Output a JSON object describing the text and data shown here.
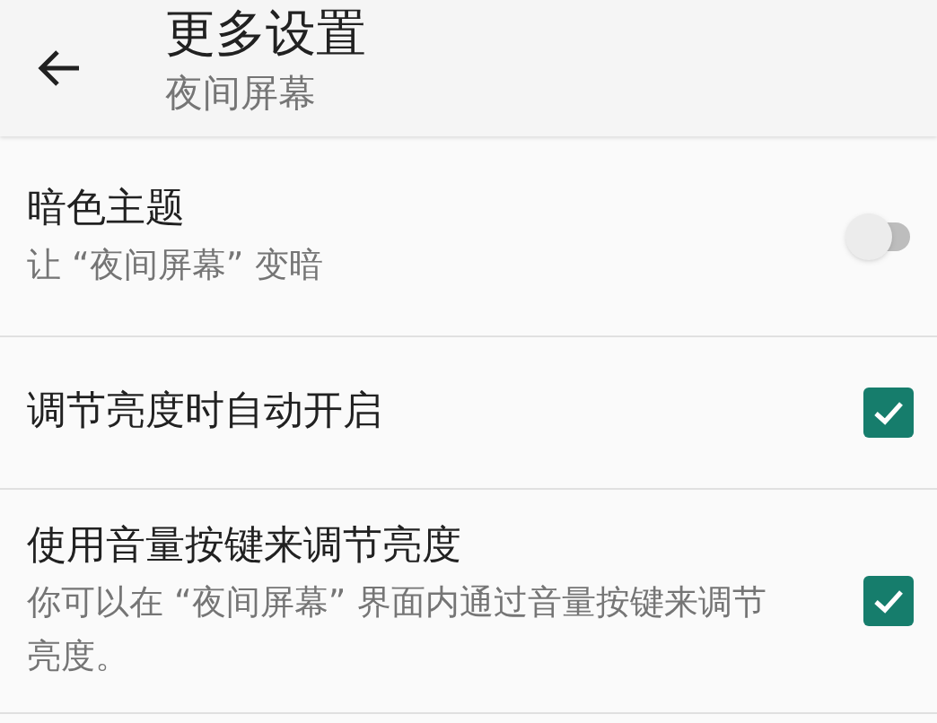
{
  "toolbar": {
    "title": "更多设置",
    "subtitle": "夜间屏幕"
  },
  "settings": [
    {
      "kind": "switch",
      "title": "暗色主题",
      "summary": "让 “夜间屏幕” 变暗",
      "on": false
    },
    {
      "kind": "checkbox",
      "title": "调节亮度时自动开启",
      "checked": true
    },
    {
      "kind": "checkbox",
      "title": "使用音量按键来调节亮度",
      "summary": "你可以在 “夜间屏幕” 界面内通过音量按键来调节亮度。",
      "checked": true
    }
  ]
}
